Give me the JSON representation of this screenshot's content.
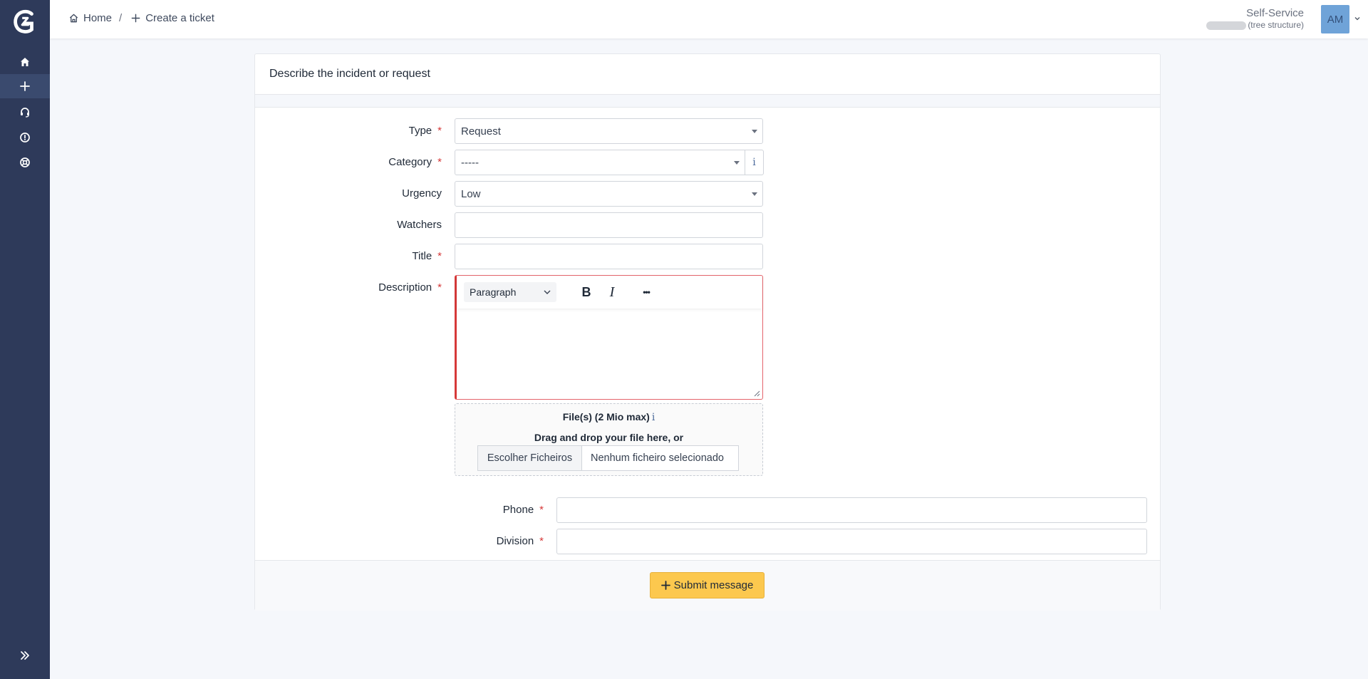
{
  "sidebar": {
    "items": [
      {
        "name": "home",
        "icon": "home-icon"
      },
      {
        "name": "create-ticket",
        "icon": "plus-icon",
        "active": true
      },
      {
        "name": "tickets",
        "icon": "headset-icon"
      },
      {
        "name": "problems",
        "icon": "alert-circle-icon"
      },
      {
        "name": "faq",
        "icon": "lifebuoy-icon"
      }
    ],
    "expand_icon": "chevrons-right-icon",
    "colors": {
      "background": "#2e3a5a",
      "active": "#3a4a6e"
    }
  },
  "header": {
    "breadcrumb": {
      "home": "Home",
      "separator": "/",
      "current": "Create a ticket"
    },
    "profile": {
      "role": "Self-Service",
      "entity_suffix": "(tree structure)",
      "initials": "AM"
    }
  },
  "form": {
    "title": "Describe the incident or request",
    "fields": {
      "type": {
        "label": "Type",
        "value": "Request",
        "required": true
      },
      "category": {
        "label": "Category",
        "value": "-----",
        "required": true,
        "info": "i"
      },
      "urgency": {
        "label": "Urgency",
        "value": "Low"
      },
      "watchers": {
        "label": "Watchers",
        "value": ""
      },
      "title": {
        "label": "Title",
        "value": "",
        "required": true
      },
      "description": {
        "label": "Description",
        "required": true,
        "format": "Paragraph",
        "bold": "B",
        "italic": "I",
        "more": "•••"
      },
      "phone": {
        "label": "Phone",
        "value": "",
        "required": true
      },
      "division": {
        "label": "Division",
        "value": "",
        "required": true
      }
    },
    "required_mark": "*",
    "files": {
      "title": "File(s) (2 Mio max)",
      "info": "i",
      "drag_text": "Drag and drop your file here, or",
      "choose_label": "Escolher Ficheiros",
      "none_selected": "Nenhum ficheiro selecionado"
    },
    "submit_label": "Submit message",
    "accent_color": "#fcc84e"
  }
}
